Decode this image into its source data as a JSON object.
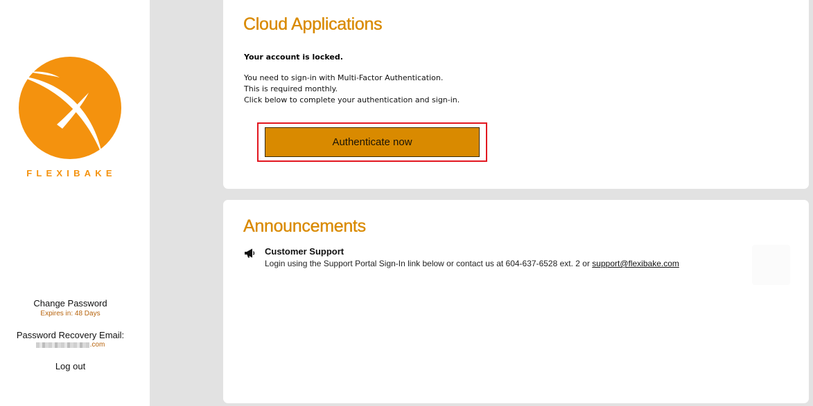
{
  "brand": {
    "name": "FLEXIBAKE",
    "color": "#f4920e"
  },
  "sidebar": {
    "change_password_label": "Change Password",
    "expires_text": "Expires in: 48 Days",
    "recovery_label": "Password Recovery Email:",
    "recovery_email_suffix": ".com",
    "logout_label": "Log out"
  },
  "apps": {
    "title": "Cloud Applications",
    "locked_text": "Your account is locked.",
    "message_lines": [
      "You need to sign-in with Multi-Factor Authentication.",
      "This is required monthly.",
      "Click below to complete your authentication and sign-in."
    ],
    "auth_button_label": "Authenticate now"
  },
  "announcements": {
    "title": "Announcements",
    "items": [
      {
        "icon": "megaphone-icon",
        "title": "Customer Support",
        "body": "Login using the Support Portal Sign-In link below or contact us at 604-637-6528 ext. 2 or ",
        "link_text": "support@flexibake.com"
      }
    ]
  },
  "colors": {
    "accent": "#d98a00",
    "highlight_border": "#e2161f",
    "sidebar_bg": "#ffffff",
    "page_bg": "#e2e2e2",
    "orange_text": "#b6620b"
  }
}
